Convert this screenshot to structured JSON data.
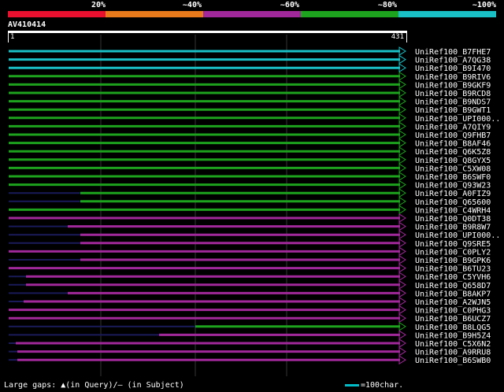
{
  "legend": {
    "labels": [
      "20%",
      "~40%",
      "~60%",
      "~80%",
      "~100%"
    ],
    "colors": [
      "#e8102e",
      "#e87a1c",
      "#a1289a",
      "#1da31d",
      "#19c0c6"
    ]
  },
  "query": {
    "name": "AV410414",
    "start": "1",
    "end": "431"
  },
  "hits": [
    {
      "label": "UniRef100_B7FHE7",
      "color": "#19c0c6"
    },
    {
      "label": "UniRef100_A7QG38",
      "color": "#19c0c6"
    },
    {
      "label": "UniRef100_B9I470",
      "color": "#19c0c6"
    },
    {
      "label": "UniRef100_B9RIV6",
      "color": "#1da31d"
    },
    {
      "label": "UniRef100_B9GKF9",
      "color": "#1da31d"
    },
    {
      "label": "UniRef100_B9RCD8",
      "color": "#1da31d"
    },
    {
      "label": "UniRef100_B9NDS7",
      "color": "#1da31d"
    },
    {
      "label": "UniRef100_B9GWT1",
      "color": "#1da31d"
    },
    {
      "label": "UniRef100_UPI000..",
      "color": "#1da31d"
    },
    {
      "label": "UniRef100_A7QIY9",
      "color": "#1da31d"
    },
    {
      "label": "UniRef100_Q9FHB7",
      "color": "#1da31d"
    },
    {
      "label": "UniRef100_B8AF46",
      "color": "#1da31d"
    },
    {
      "label": "UniRef100_Q6K5Z8",
      "color": "#1da31d"
    },
    {
      "label": "UniRef100_Q8GYX5",
      "color": "#1da31d"
    },
    {
      "label": "UniRef100_C5XW08",
      "color": "#1da31d"
    },
    {
      "label": "UniRef100_B6SWF0",
      "color": "#1da31d"
    },
    {
      "label": "UniRef100_Q93W23",
      "color": "#1da31d"
    },
    {
      "label": "UniRef100_A0FIZ9",
      "color": "#1da31d"
    },
    {
      "label": "UniRef100_Q65600",
      "color": "#1da31d"
    },
    {
      "label": "UniRef100_C4WRH4",
      "color": "#1da31d"
    },
    {
      "label": "UniRef100_Q0DT38",
      "color": "#a1289a"
    },
    {
      "label": "UniRef100_B9R8W7",
      "color": "#a1289a"
    },
    {
      "label": "UniRef100_UPI000..",
      "color": "#a1289a"
    },
    {
      "label": "UniRef100_Q9SRE5",
      "color": "#a1289a"
    },
    {
      "label": "UniRef100_C0PLY2",
      "color": "#a1289a"
    },
    {
      "label": "UniRef100_B9GPK6",
      "color": "#a1289a"
    },
    {
      "label": "UniRef100_B6TU23",
      "color": "#a1289a"
    },
    {
      "label": "UniRef100_C5YVH6",
      "color": "#a1289a"
    },
    {
      "label": "UniRef100_Q658D7",
      "color": "#a1289a"
    },
    {
      "label": "UniRef100_B8AKP7",
      "color": "#a1289a"
    },
    {
      "label": "UniRef100_A2WJN5",
      "color": "#a1289a"
    },
    {
      "label": "UniRef100_C0PHG3",
      "color": "#a1289a"
    },
    {
      "label": "UniRef100_B6UCZ7",
      "color": "#a1289a"
    },
    {
      "label": "UniRef100_B8LQG5",
      "color": "#1da31d"
    },
    {
      "label": "UniRef100_B9H5Z4",
      "color": "#a1289a"
    },
    {
      "label": "UniRef100_C5X6N2",
      "color": "#a1289a"
    },
    {
      "label": "UniRef100_A9RRU8",
      "color": "#a1289a"
    },
    {
      "label": "UniRef100_B6SWB0",
      "color": "#a1289a"
    }
  ],
  "footer": {
    "gaps_text": "Large gaps: ▲(in Query)/— (in Subject)",
    "scale_text": "=100char."
  }
}
